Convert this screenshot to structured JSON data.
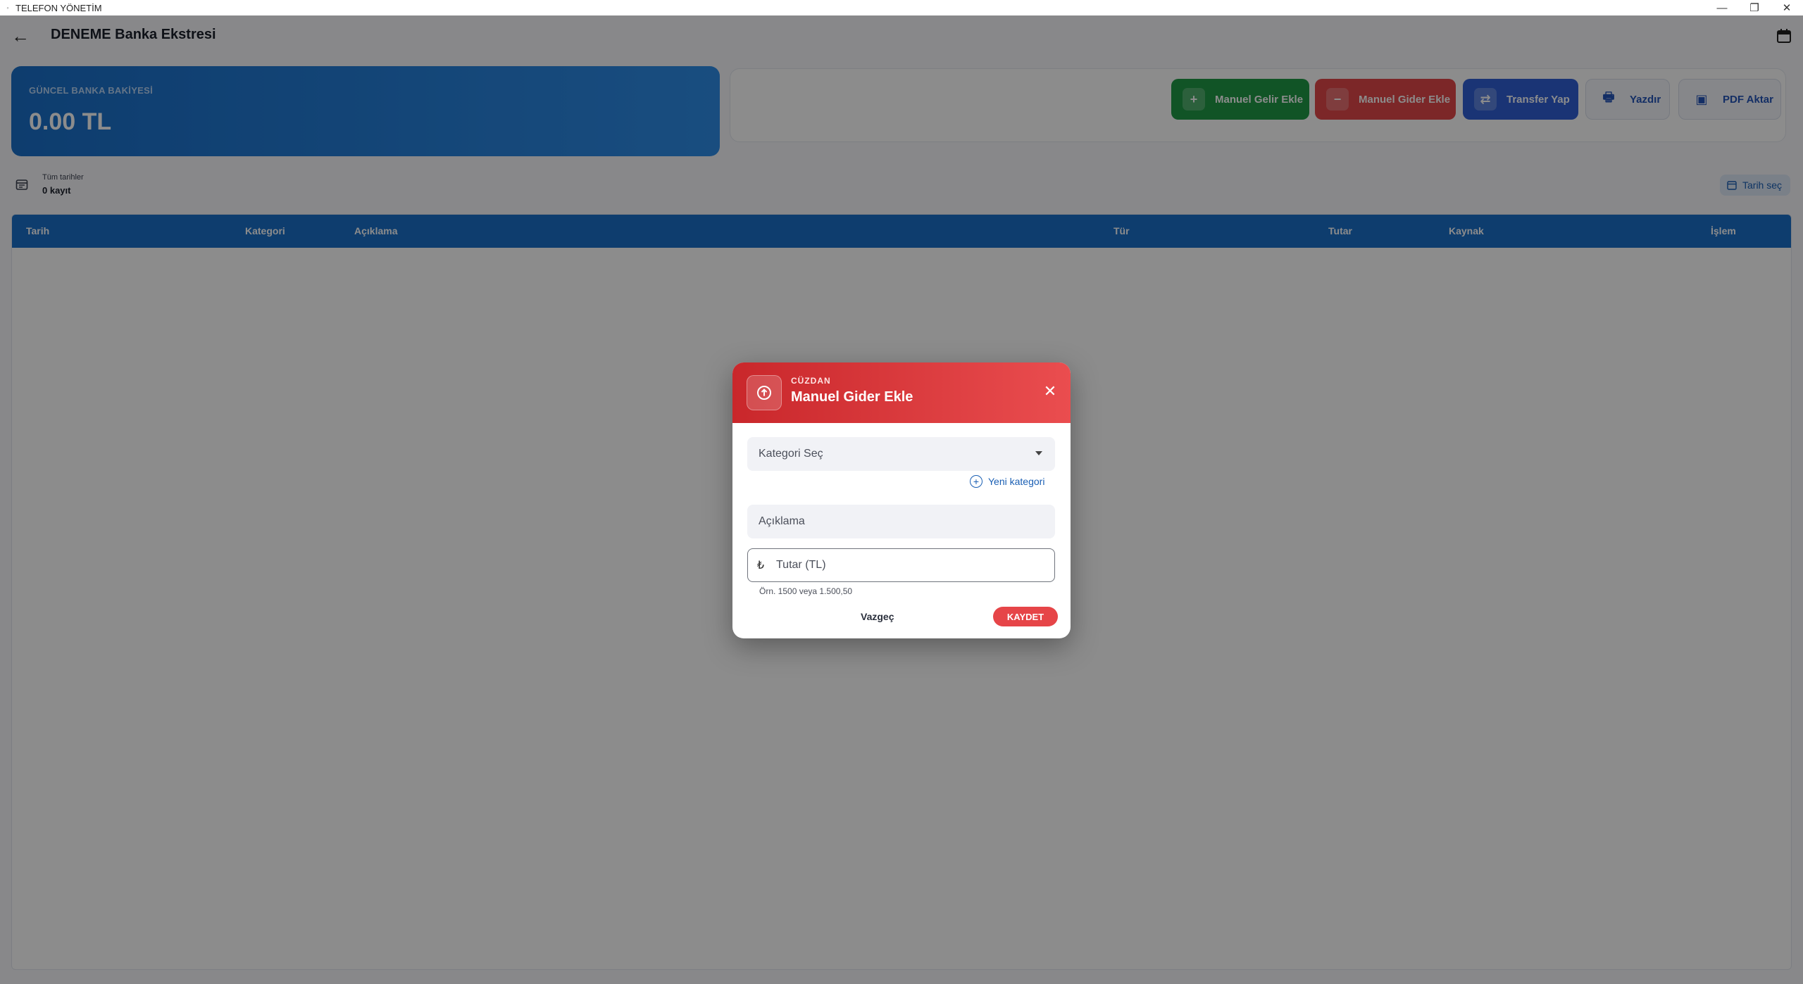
{
  "window": {
    "title": "TELEFON YÖNETİM",
    "minimize": "—",
    "restore": "❐",
    "close": "✕"
  },
  "appbar": {
    "back_icon": "←",
    "title": "DENEME Banka Ekstresi"
  },
  "balance": {
    "label": "GÜNCEL BANKA BAKİYESİ",
    "value": "0.00 TL"
  },
  "actions": {
    "income": {
      "label": "Manuel Gelir Ekle",
      "icon": "+"
    },
    "expense": {
      "label": "Manuel Gider Ekle",
      "icon": "−"
    },
    "transfer": {
      "label": "Transfer Yap",
      "icon": "⇄"
    },
    "print": {
      "label": "Yazdır",
      "icon": "🖶"
    },
    "pdf": {
      "label": "PDF Aktar",
      "icon": "▣"
    }
  },
  "filter": {
    "range": "Tüm tarihler",
    "count": "0 kayıt",
    "date_button": "Tarih seç"
  },
  "table": {
    "columns": [
      "Tarih",
      "Kategori",
      "Açıklama",
      "Tür",
      "Tutar",
      "Kaynak",
      "İşlem"
    ]
  },
  "dialog": {
    "eyebrow": "CÜZDAN",
    "title": "Manuel Gider Ekle",
    "close_icon": "✕",
    "category_placeholder": "Kategori Seç",
    "new_category": "Yeni kategori",
    "new_category_icon": "+",
    "description_placeholder": "Açıklama",
    "currency_symbol": "₺",
    "amount_placeholder": "Tutar (TL)",
    "hint": "Örn. 1500 veya 1.500,50",
    "cancel": "Vazgeç",
    "save": "KAYDET"
  },
  "colors": {
    "primary_blue": "#1a6fc9",
    "income_green": "#1f9a45",
    "expense_red": "#e2474a",
    "transfer_blue": "#3160d6"
  }
}
